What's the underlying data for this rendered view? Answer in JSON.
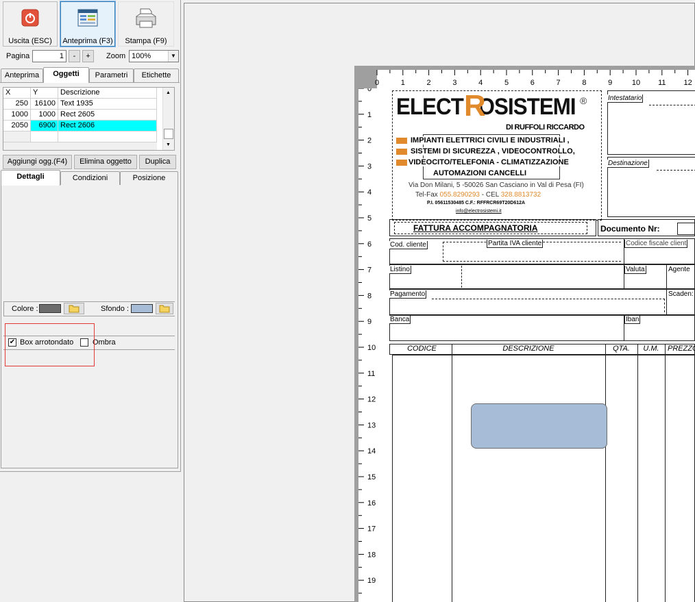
{
  "toolbar": {
    "exit_label": "Uscita (ESC)",
    "preview_label": "Anteprima (F3)",
    "print_label": "Stampa (F9)"
  },
  "paging": {
    "page_label": "Pagina",
    "page_value": "1",
    "minus": "-",
    "plus": "+",
    "zoom_label": "Zoom",
    "zoom_value": "100%"
  },
  "main_tabs": [
    "Anteprima",
    "Oggetti",
    "Parametri",
    "Etichette"
  ],
  "objects_table": {
    "headers": [
      "X",
      "Y",
      "Descrizione"
    ],
    "rows": [
      {
        "x": "250",
        "y": "16100",
        "desc": "Text 1935"
      },
      {
        "x": "1000",
        "y": "1000",
        "desc": "Rect 2605"
      },
      {
        "x": "2050",
        "y": "6900",
        "desc": "Rect 2606"
      }
    ]
  },
  "object_buttons": {
    "add": "Aggiungi ogg.(F4)",
    "delete": "Elimina oggetto",
    "duplicate": "Duplica"
  },
  "detail_tabs": [
    "Dettagli",
    "Condizioni",
    "Posizione"
  ],
  "details": {
    "color_label": "Colore :",
    "color_value": "#6d6d6d",
    "background_label": "Sfondo :",
    "background_value": "#a7bcd6",
    "rounded_label": "Box arrotondato",
    "rounded_checked": true,
    "shadow_label": "Ombra",
    "shadow_checked": false
  },
  "ruler": {
    "h_ticks": [
      "0",
      "1",
      "2",
      "3",
      "4",
      "5",
      "6",
      "7",
      "8",
      "9",
      "10",
      "11",
      "12"
    ],
    "v_ticks": [
      "0",
      "1",
      "2",
      "3",
      "4",
      "5",
      "6",
      "7",
      "8",
      "9",
      "10",
      "11",
      "12",
      "13",
      "14",
      "15",
      "16",
      "17",
      "18",
      "19"
    ]
  },
  "invoice": {
    "company": "ELECTROSISTEMI",
    "company_sub": "DI RUFFOLI RICCARDO",
    "services": [
      "IMPIANTI ELETTRICI CIVILI E  INDUSTRIALI ,",
      "SISTEMI DI SICUREZZA , VIDEOCONTROLLO,",
      "VIDEOCITO/TELEFONIA - CLIMATIZZAZIONE",
      "AUTOMAZIONI CANCELLI"
    ],
    "address": "Via Don Milani, 5 -50026 San Casciano in Val di Pesa (FI)",
    "phone_label": "Tel-Fax",
    "phone": "055.8290293",
    "cell_label": "CEL",
    "cell": "328.8813732",
    "vat": "P.I. 05611530485 C.F.: RFFRCR69T20D612A",
    "email": "info@electrosistemi.it",
    "intestatario": "Intestatario",
    "destinazione": "Destinazione",
    "doc_title": "FATTURA ACCOMPAGNATORIA",
    "doc_number": "Documento Nr:",
    "cod_cliente": "Cod. cliente",
    "partita_iva": "Partita IVA cliente",
    "codice_fiscale": "Codice fiscale client",
    "listino": "Listino",
    "valuta": "Valuta",
    "agente": "Agente",
    "pagamento": "Pagamento",
    "scadenza": "Scaden:",
    "banca": "Banca",
    "iban": "Iban",
    "col_codice": "CODICE",
    "col_descrizione": "DESCRIZIONE",
    "col_qta": "QTA.",
    "col_um": "U.M.",
    "col_prezzo": "PREZZO"
  }
}
